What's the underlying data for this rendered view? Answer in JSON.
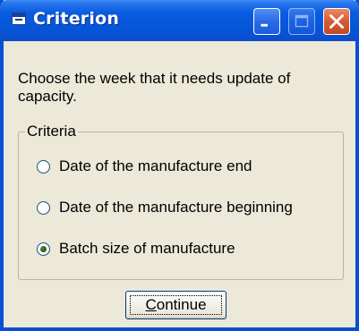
{
  "window": {
    "title": "Criterion",
    "controls": {
      "minimize": "minimize-icon",
      "maximize": "maximize-icon",
      "close": "close-icon"
    },
    "colors": {
      "titlebar": "#0655d8",
      "frame": "#0a4fd4",
      "face": "#ece9d8",
      "close_button": "#d85a34"
    }
  },
  "dialog": {
    "prompt": "Choose the week that it needs update of capacity.",
    "group_label": "Criteria",
    "options": [
      {
        "label": "Date of the manufacture end",
        "selected": false
      },
      {
        "label": "Date of the manufacture beginning",
        "selected": false
      },
      {
        "label": "Batch size of manufacture",
        "selected": true
      }
    ],
    "continue_button": {
      "accelerator": "C",
      "rest": "ontinue"
    }
  }
}
